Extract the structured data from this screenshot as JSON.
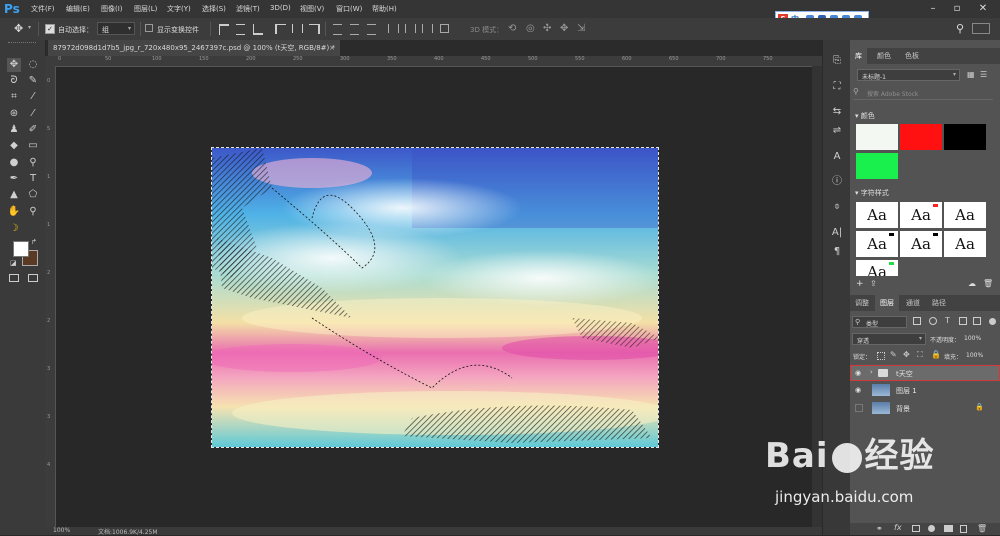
{
  "app": {
    "logo": "Ps"
  },
  "menu": [
    "文件(F)",
    "编辑(E)",
    "图像(I)",
    "图层(L)",
    "文字(Y)",
    "选择(S)",
    "滤镜(T)",
    "3D(D)",
    "视图(V)",
    "窗口(W)",
    "帮助(H)"
  ],
  "ime": {
    "label": "中"
  },
  "options": {
    "auto_select_label": "自动选择：",
    "auto_select_value": "组",
    "show_transform_label": "显示变换控件",
    "mode_3d_label": "3D 模式："
  },
  "document": {
    "tab_title": "87972d098d1d7b5_jpg_r_720x480x95_2467397c.psd @ 100% (t天空, RGB/8#) *",
    "zoom": "100%",
    "doc_size": "文档:1006.9K/4.25M"
  },
  "rulers": {
    "h": [
      "0",
      "50",
      "100",
      "150",
      "200",
      "250",
      "300",
      "350",
      "400",
      "450",
      "500",
      "550",
      "600",
      "650",
      "700",
      "750"
    ],
    "v": [
      "0",
      "5",
      "1",
      "1",
      "2",
      "2",
      "3",
      "3",
      "4"
    ]
  },
  "libraries_panel": {
    "tabs": [
      "库",
      "颜色",
      "色板"
    ],
    "library_select": "未标题-1",
    "search_placeholder": "搜索 Adobe Stock",
    "colors_title": "颜色",
    "char_styles_title": "字符样式",
    "aa_label": "Aa",
    "swatches": [
      "#f4f8f3",
      "#ff1111",
      "#000000",
      "#19f04e"
    ],
    "aa_flags": [
      "",
      "#ff2020",
      "",
      "#000000",
      "#000000",
      "",
      "#22dd44"
    ]
  },
  "layers_panel": {
    "tabs": [
      "调整",
      "图层",
      "通道",
      "路径"
    ],
    "filter_kind": "类型",
    "blend_mode": "穿透",
    "opacity_label": "不透明度：",
    "opacity_value": "100%",
    "lock_label": "锁定：",
    "fill_label": "填充：",
    "fill_value": "100%",
    "layers": [
      {
        "name": "t天空",
        "type": "group",
        "selected": true
      },
      {
        "name": "图层 1",
        "type": "layer",
        "selected": false
      },
      {
        "name": "背景",
        "type": "background",
        "selected": false
      }
    ]
  },
  "watermark": {
    "logo": "Bai",
    "logo_tail": "经验",
    "url": "jingyan.baidu.com"
  }
}
